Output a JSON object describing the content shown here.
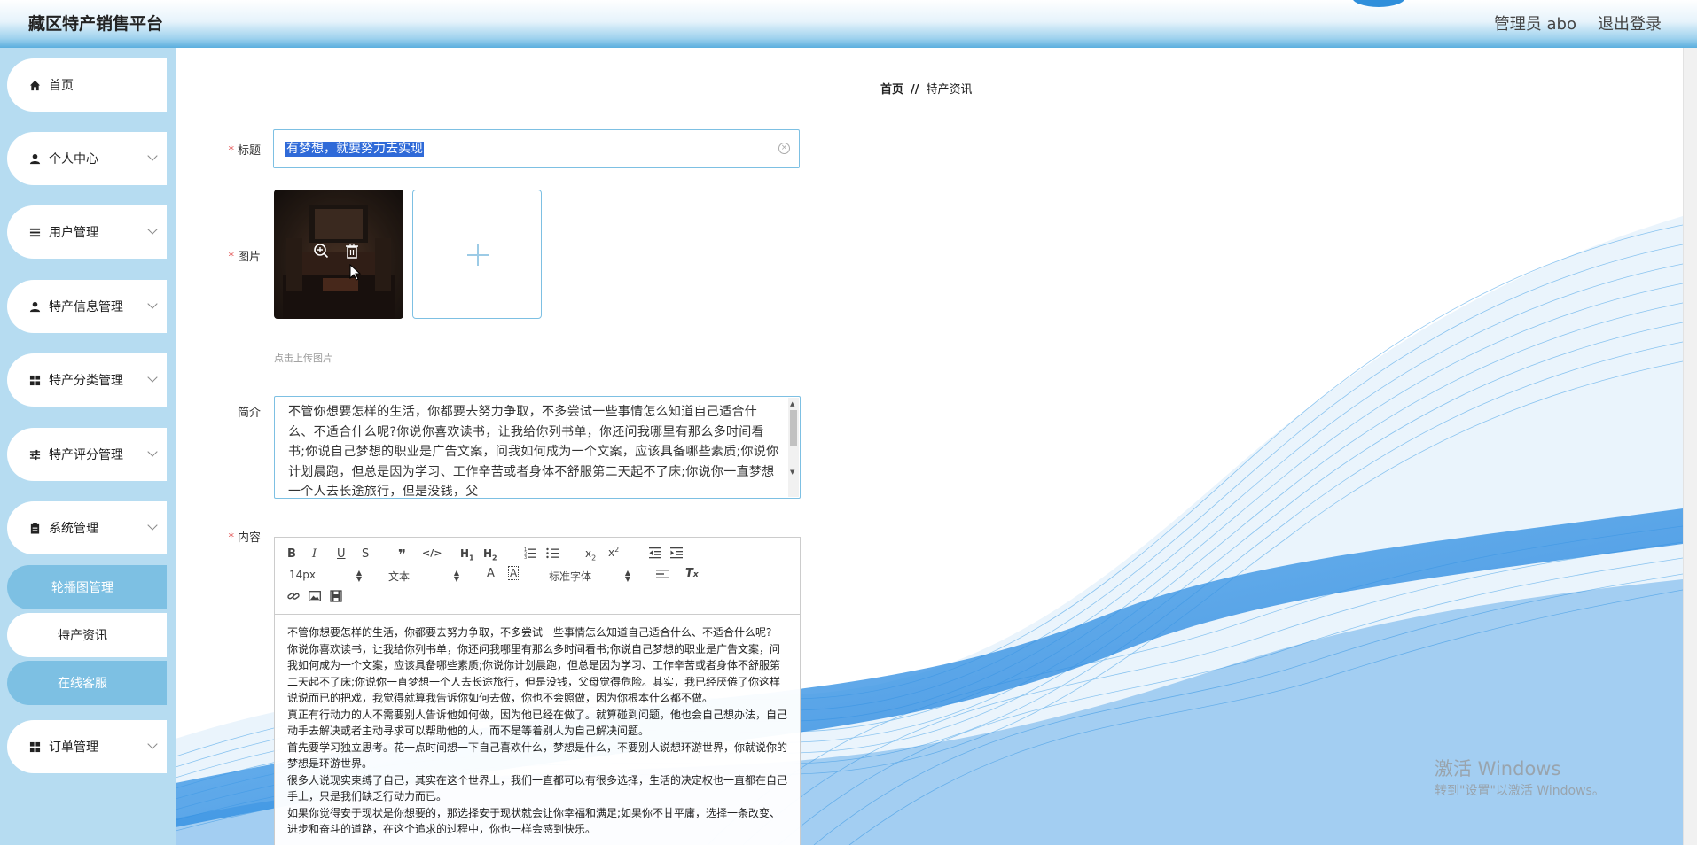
{
  "header": {
    "app_title": "藏区特产销售平台",
    "admin_label": "管理员 abo",
    "logout_label": "退出登录"
  },
  "sidebar": {
    "items": [
      {
        "label": "首页",
        "icon": "home-icon"
      },
      {
        "label": "个人中心",
        "icon": "person-icon"
      },
      {
        "label": "用户管理",
        "icon": "list-icon"
      },
      {
        "label": "特产信息管理",
        "icon": "person-icon"
      },
      {
        "label": "特产分类管理",
        "icon": "grid-icon"
      },
      {
        "label": "特产评分管理",
        "icon": "sliders-icon"
      },
      {
        "label": "系统管理",
        "icon": "clipboard-icon"
      }
    ],
    "sub_items": [
      {
        "label": "轮播图管理",
        "style": "blue"
      },
      {
        "label": "特产资讯",
        "style": "white"
      },
      {
        "label": "在线客服",
        "style": "blue"
      }
    ],
    "last_item": {
      "label": "订单管理",
      "icon": "grid-icon"
    }
  },
  "breadcrumb": {
    "home": "首页",
    "separator": "//",
    "current": "特产资讯"
  },
  "form": {
    "title_label": "标题",
    "title_value": "有梦想，就要努力去实现",
    "image_label": "图片",
    "upload_hint": "点击上传图片",
    "intro_label": "简介",
    "intro_text": "不管你想要怎样的生活，你都要去努力争取，不多尝试一些事情怎么知道自己适合什么、不适合什么呢?你说你喜欢读书，让我给你列书单，你还问我哪里有那么多时间看书;你说自己梦想的职业是广告文案，问我如何成为一个文案，应该具备哪些素质;你说你计划晨跑，但总是因为学习、工作辛苦或者身体不舒服第二天起不了床;你说你一直梦想一个人去长途旅行，但是没钱，父",
    "content_label": "内容"
  },
  "editor": {
    "font_size": "14px",
    "text_style": "文本",
    "font_family": "标准字体",
    "paragraphs": [
      "不管你想要怎样的生活，你都要去努力争取，不多尝试一些事情怎么知道自己适合什么、不适合什么呢?",
      "你说你喜欢读书，让我给你列书单，你还问我哪里有那么多时间看书;你说自己梦想的职业是广告文案，问我如何成为一个文案，应该具备哪些素质;你说你计划晨跑，但总是因为学习、工作辛苦或者身体不舒服第二天起不了床;你说你一直梦想一个人去长途旅行，但是没钱，父母觉得危险。其实，我已经厌倦了你这样说说而已的把戏，我觉得就算我告诉你如何去做，你也不会照做，因为你根本什么都不做。",
      "真正有行动力的人不需要别人告诉他如何做，因为他已经在做了。就算碰到问题，他也会自己想办法，自己动手去解决或者主动寻求可以帮助他的人，而不是等着别人为自己解决问题。",
      "首先要学习独立思考。花一点时间想一下自己喜欢什么，梦想是什么，不要别人说想环游世界，你就说你的梦想是环游世界。",
      "很多人说现实束缚了自己，其实在这个世界上，我们一直都可以有很多选择，生活的决定权也一直都在自己手上，只是我们缺乏行动力而已。",
      "如果你觉得安于现状是你想要的，那选择安于现状就会让你幸福和满足;如果你不甘平庸，选择一条改变、进步和奋斗的道路，在这个追求的过程中，你也一样会感到快乐。"
    ]
  },
  "watermark": {
    "line1": "激活 Windows",
    "line2": "转到\"设置\"以激活 Windows。"
  },
  "colors": {
    "accent": "#7dc0e3",
    "sidebar_bg": "#b6dcf1",
    "required": "#e04b4b",
    "wave": "#1e88e5"
  }
}
